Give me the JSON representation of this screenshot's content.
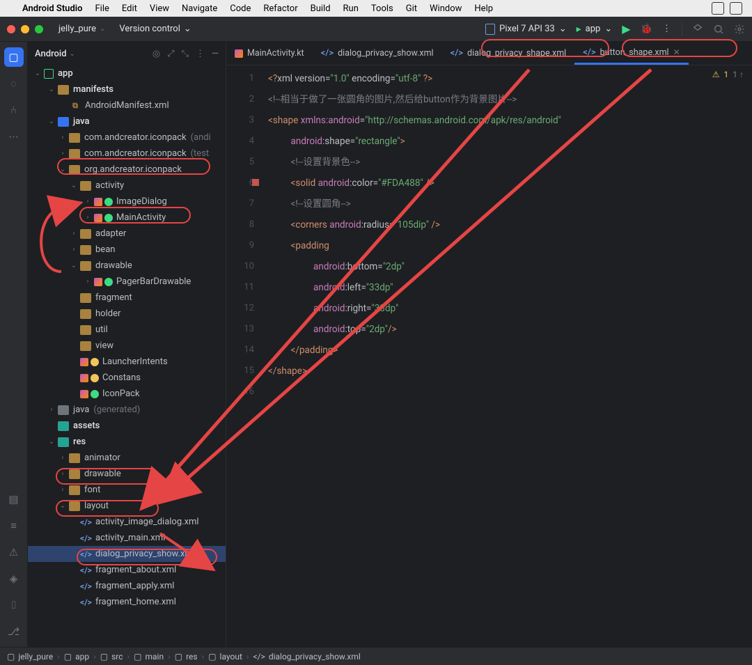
{
  "menubar": {
    "app": "Android Studio",
    "items": [
      "File",
      "Edit",
      "View",
      "Navigate",
      "Code",
      "Refactor",
      "Build",
      "Run",
      "Tools",
      "Git",
      "Window",
      "Help"
    ]
  },
  "titlebar": {
    "project": "jelly_pure",
    "vcs": "Version control",
    "device": "Pixel 7 API 33",
    "run_config": "app"
  },
  "project_selector": "Android",
  "tree": {
    "app": "app",
    "manifests": "manifests",
    "android_manifest": "AndroidManifest.xml",
    "java": "java",
    "pkg1": "com.andcreator.iconpack",
    "pkg1_hint": "(andi",
    "pkg2": "com.andcreator.iconpack",
    "pkg2_hint": "(test",
    "pkg3": "org.andcreator.iconpack",
    "activity": "activity",
    "ImageDialog": "ImageDialog",
    "MainActivity": "MainActivity",
    "adapter": "adapter",
    "bean": "bean",
    "drawable_pkg": "drawable",
    "PagerBarDrawable": "PagerBarDrawable",
    "fragment": "fragment",
    "holder": "holder",
    "util": "util",
    "view": "view",
    "LauncherIntents": "LauncherIntents",
    "Constans": "Constans",
    "IconPack": "IconPack",
    "java_gen": "java",
    "java_gen_hint": "(generated)",
    "assets": "assets",
    "res": "res",
    "animator": "animator",
    "drawable": "drawable",
    "font": "font",
    "layout": "layout",
    "l1": "activity_image_dialog.xml",
    "l2": "activity_main.xml",
    "l3": "dialog_privacy_show.xml",
    "l4": "fragment_about.xml",
    "l5": "fragment_apply.xml",
    "l6": "fragment_home.xml"
  },
  "tabs": {
    "t1": "MainActivity.kt",
    "t2": "dialog_privacy_show.xml",
    "t3": "dialog_privacy_shape.xml",
    "t4": "button_shape.xml"
  },
  "warnings": {
    "count": "1",
    "upcount": "1 ↑"
  },
  "code": {
    "l1_a": "<?",
    "l1_b": "xml version",
    "l1_c": "=",
    "l1_d": "\"1.0\"",
    "l1_e": " encoding",
    "l1_f": "=",
    "l1_g": "\"utf-8\"",
    "l1_h": " ?>",
    "l2": "<!--相当于做了一张圆角的图片,然后给button作为背景图片-->",
    "l3_a": "<",
    "l3_b": "shape ",
    "l3_c": "xmlns:",
    "l3_d": "android",
    "l3_e": "=",
    "l3_f": "\"http://schemas.android.com/apk/res/android\"",
    "l4_a": "android",
    "l4_b": ":shape",
    "l4_c": "=",
    "l4_d": "\"rectangle\"",
    "l4_e": ">",
    "l5": "<!--设置背景色-->",
    "l6_a": "<",
    "l6_b": "solid ",
    "l6_c": "android",
    "l6_d": ":color",
    "l6_e": "=",
    "l6_f": "\"#FDA488\"",
    "l6_g": " />",
    "l7": "<!--设置圆角-->",
    "l8_a": "<",
    "l8_b": "corners ",
    "l8_c": "android",
    "l8_d": ":radius",
    "l8_e": "=",
    "l8_f": "\"105dip\"",
    "l8_g": " />",
    "l9_a": "<",
    "l9_b": "padding",
    "l10_a": "android",
    "l10_b": ":bottom",
    "l10_c": "=",
    "l10_d": "\"2dp\"",
    "l11_a": "android",
    "l11_b": ":left",
    "l11_c": "=",
    "l11_d": "\"33dp\"",
    "l12_a": "android",
    "l12_b": ":right",
    "l12_c": "=",
    "l12_d": "\"33dp\"",
    "l13_a": "android",
    "l13_b": ":top",
    "l13_c": "=",
    "l13_d": "\"2dp\"",
    "l13_e": "/>",
    "l14_a": "</",
    "l14_b": "padding",
    "l14_c": ">",
    "l15_a": "</",
    "l15_b": "shape",
    "l15_c": ">"
  },
  "gutter": [
    "1",
    "2",
    "3",
    "4",
    "5",
    "6",
    "7",
    "8",
    "9",
    "10",
    "11",
    "12",
    "13",
    "14",
    "15",
    "16"
  ],
  "breadcrumb": {
    "c1": "jelly_pure",
    "c2": "app",
    "c3": "src",
    "c4": "main",
    "c5": "res",
    "c6": "layout",
    "c7": "dialog_privacy_show.xml"
  }
}
